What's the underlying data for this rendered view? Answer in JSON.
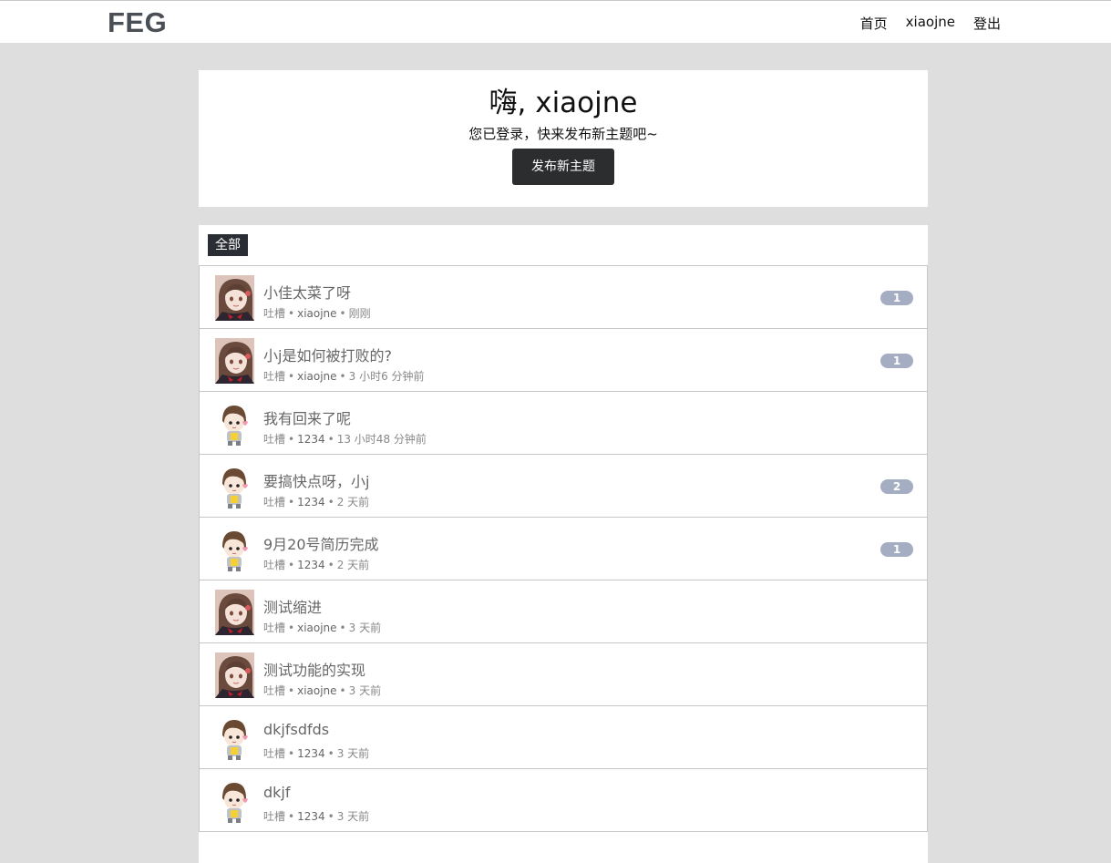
{
  "header": {
    "logo": "FEG",
    "nav": [
      "首页",
      "xiaojne",
      "登出"
    ]
  },
  "hero": {
    "title": "嗨, xiaojne",
    "subtitle": "您已登录，快来发布新主题吧~",
    "button_label": "发布新主题"
  },
  "filter": {
    "active_label": "全部"
  },
  "topics": [
    {
      "title": "小佳太菜了呀",
      "category": "吐槽",
      "author": "xiaojne",
      "time": "刚刚",
      "replies": "1",
      "avatar": "girl-avatar"
    },
    {
      "title": "小j是如何被打败的?",
      "category": "吐槽",
      "author": "xiaojne",
      "time": "3 小时6 分钟前",
      "replies": "1",
      "avatar": "girl-avatar"
    },
    {
      "title": "我有回来了呢",
      "category": "吐槽",
      "author": "1234",
      "time": "13 小时48 分钟前",
      "replies": "",
      "avatar": "boy-avatar"
    },
    {
      "title": "要搞快点呀，小j",
      "category": "吐槽",
      "author": "1234",
      "time": "2 天前",
      "replies": "2",
      "avatar": "boy-avatar"
    },
    {
      "title": "9月20号简历完成",
      "category": "吐槽",
      "author": "1234",
      "time": "2 天前",
      "replies": "1",
      "avatar": "boy-avatar"
    },
    {
      "title": "测试缩进",
      "category": "吐槽",
      "author": "xiaojne",
      "time": "3 天前",
      "replies": "",
      "avatar": "girl-avatar"
    },
    {
      "title": "测试功能的实现",
      "category": "吐槽",
      "author": "xiaojne",
      "time": "3 天前",
      "replies": "",
      "avatar": "girl-avatar"
    },
    {
      "title": "dkjfsdfds",
      "category": "吐槽",
      "author": "1234",
      "time": "3 天前",
      "replies": "",
      "avatar": "boy-avatar"
    },
    {
      "title": "dkjf",
      "category": "吐槽",
      "author": "1234",
      "time": "3 天前",
      "replies": "",
      "avatar": "boy-avatar"
    }
  ],
  "colors": {
    "background": "#dedede",
    "button": "#2c2d2f",
    "badge": "#a5adc3"
  }
}
